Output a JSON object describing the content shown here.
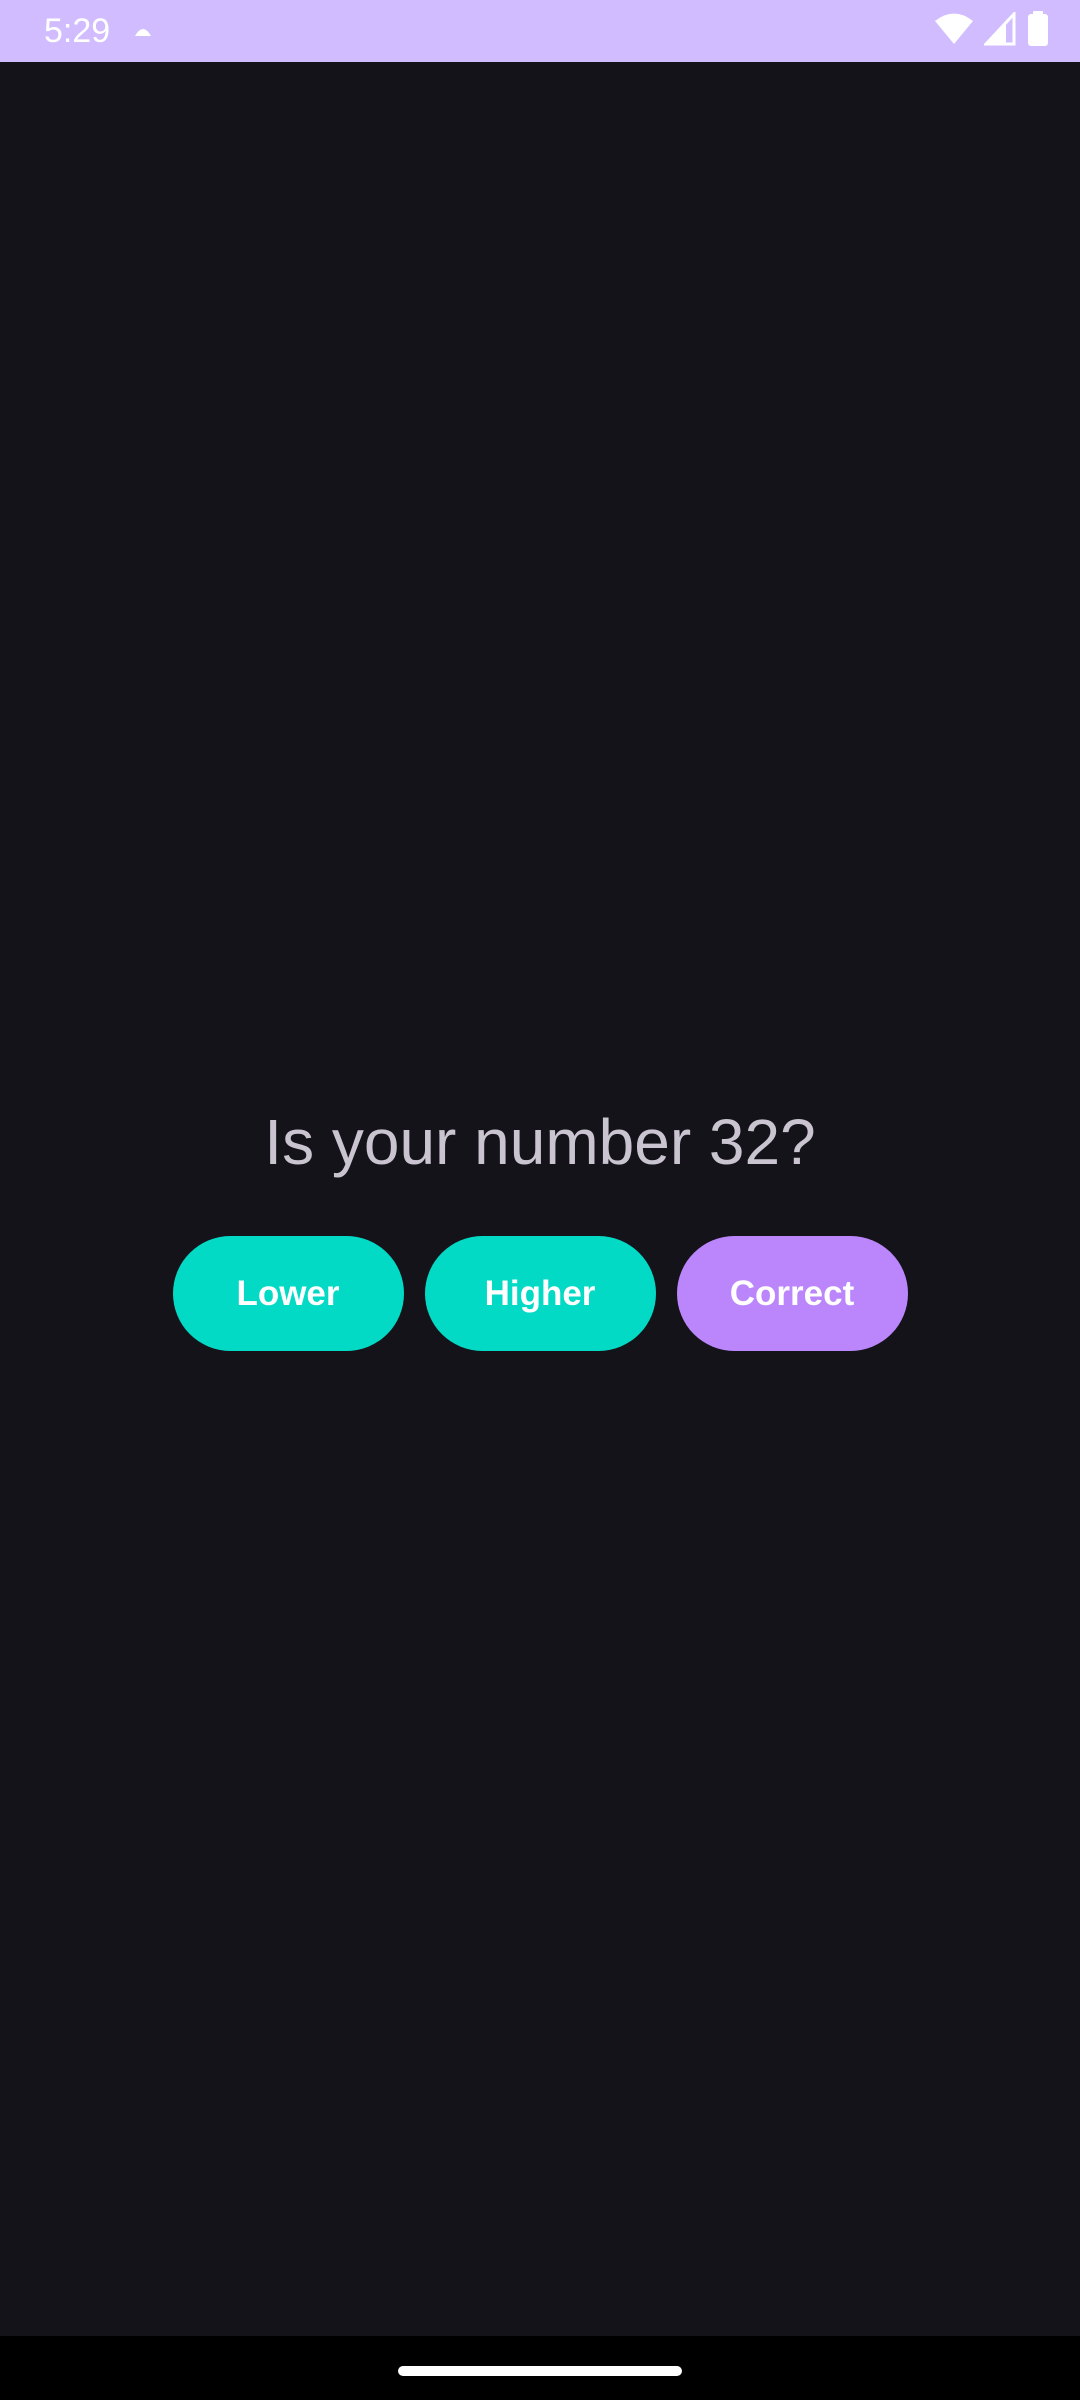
{
  "status_bar": {
    "time": "5:29",
    "background": "#d0bcfe",
    "icons": [
      "notification-icon",
      "wifi-icon",
      "cell-signal-icon",
      "battery-icon"
    ]
  },
  "main": {
    "question": "Is your number 32?",
    "background": "#15131a"
  },
  "buttons": {
    "lower": {
      "label": "Lower",
      "color": "#03dac5"
    },
    "higher": {
      "label": "Higher",
      "color": "#03dac5"
    },
    "correct": {
      "label": "Correct",
      "color": "#bb86fc"
    }
  }
}
